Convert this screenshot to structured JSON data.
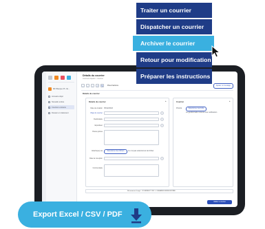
{
  "colors": {
    "menu_bg": "#1f3c87",
    "menu_highlight": "#3ab0e0",
    "export_bg": "#3ab0e0",
    "device": "#1b1e23",
    "primary": "#2c4fb8"
  },
  "context_menu": {
    "items": [
      {
        "label": "Traiter un courrier",
        "highlighted": false
      },
      {
        "label": "Dispatcher un courrier",
        "highlighted": false
      },
      {
        "label": "Archiver le courrier",
        "highlighted": true
      },
      {
        "label": "Retour pour modification",
        "highlighted": false
      },
      {
        "label": "Préparer les instructions",
        "highlighted": false
      }
    ]
  },
  "export_button": {
    "label": "Export Excel / CSV / PDF",
    "icon": "download-arrow-icon"
  },
  "app": {
    "sidebar": {
      "entity": "MFI Banque Pl. cfe...",
      "items": [
        "Annuaire objet",
        "Nouvelle entrée",
        "Courriers entrants",
        "Dossier en traitement"
      ]
    },
    "header": {
      "title": "Détails du courrier",
      "subtitle": "Courriers départs > Courrier"
    },
    "toolbar": {
      "select_label": "Plus d'actions",
      "action_button": "Ajouter un message"
    },
    "section_title": "Détails du courrier",
    "detail_panel": {
      "title": "Détails du courrier",
      "labels": [
        "Date de création",
        "Objet du courrier",
        "Destinataire",
        "Expéditeur",
        "Pièces jointes"
      ],
      "date_value": "05/12/2022",
      "attach_button": "Sélectionner des fichiers",
      "attach_note": "Je n'ai pas sélectionné de fichier",
      "extra_labels": [
        "Attaché(es) via",
        "Date de réception",
        "Commentaire"
      ]
    },
    "side_panel": {
      "title": "Courrier",
      "label": "Priorité",
      "button": "Sélectionner la priorité",
      "note": "Le gestionnaire recevra une notification"
    },
    "footer_text": "Récemment chargé : COURRIER TYPE 1 - DEMANDE ENREGISTRÉE",
    "save_button": "Valider le courrier"
  }
}
